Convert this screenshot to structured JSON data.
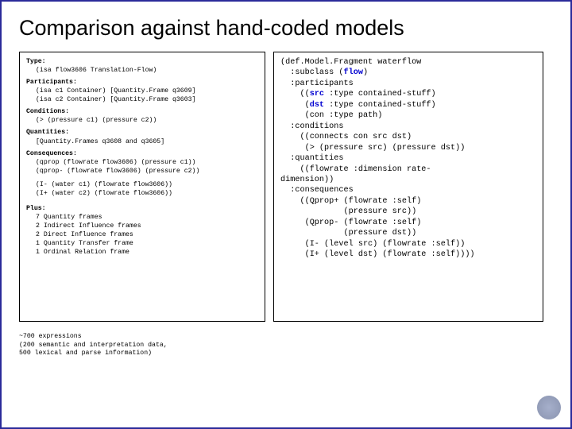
{
  "title": "Comparison against hand-coded models",
  "left": {
    "type_label": "Type:",
    "type_line": "(isa flow3606 Translation-Flow)",
    "participants_label": "Participants:",
    "participants_l1": "(isa c1 Container) [Quantity.Frame q3609]",
    "participants_l2": "(isa c2 Container) [Quantity.Frame q3603]",
    "conditions_label": "Conditions:",
    "conditions_l1": "(> (pressure c1) (pressure c2))",
    "quantities_label": "Quantities:",
    "quantities_l1": "[Quantity.Frames q3608 and q3605]",
    "consequences_label": "Consequences:",
    "conseq_l1": "(qprop (flowrate flow3606) (pressure c1))",
    "conseq_l2": "(qprop- (flowrate flow3606) (pressure c2))",
    "conseq_l3": "(I- (water c1) (flowrate flow3606))",
    "conseq_l4": "(I+ (water c2) (flowrate flow3606))",
    "plus_label": "Plus:",
    "p1": "7 Quantity frames",
    "p2": "2 Indirect Influence frames",
    "p3": "2 Direct Influence frames",
    "p4": "1 Quantity Transfer frame",
    "p5": "1 Ordinal Relation frame"
  },
  "right": {
    "l1a": "(def.Model.Fragment waterflow",
    "l2a": "  :subclass (",
    "l2b": "flow",
    "l2c": ")",
    "l3": "  :participants",
    "l4a": "    ((",
    "l4b": "src",
    "l4c": " :type contained-stuff)",
    "l5a": "     (",
    "l5b": "dst",
    "l5c": " :type contained-stuff)",
    "l6": "     (con :type path)",
    "l7": "  :conditions",
    "l8": "    ((connects con src dst)",
    "l9": "     (> (pressure src) (pressure dst))",
    "l10": "  :quantities",
    "l11": "    ((flowrate :dimension rate-",
    "l12": "dimension))",
    "l13": "  :consequences",
    "l14": "    ((Qprop+ (flowrate :self)",
    "l15": "             (pressure src))",
    "l16": "     (Qprop- (flowrate :self)",
    "l17": "             (pressure dst))",
    "l18": "     (I- (level src) (flowrate :self))",
    "l19": "     (I+ (level dst) (flowrate :self))))"
  },
  "footer": {
    "f1": "~700 expressions",
    "f2": "(200 semantic and interpretation data,",
    "f3": " 500 lexical and parse information)"
  }
}
